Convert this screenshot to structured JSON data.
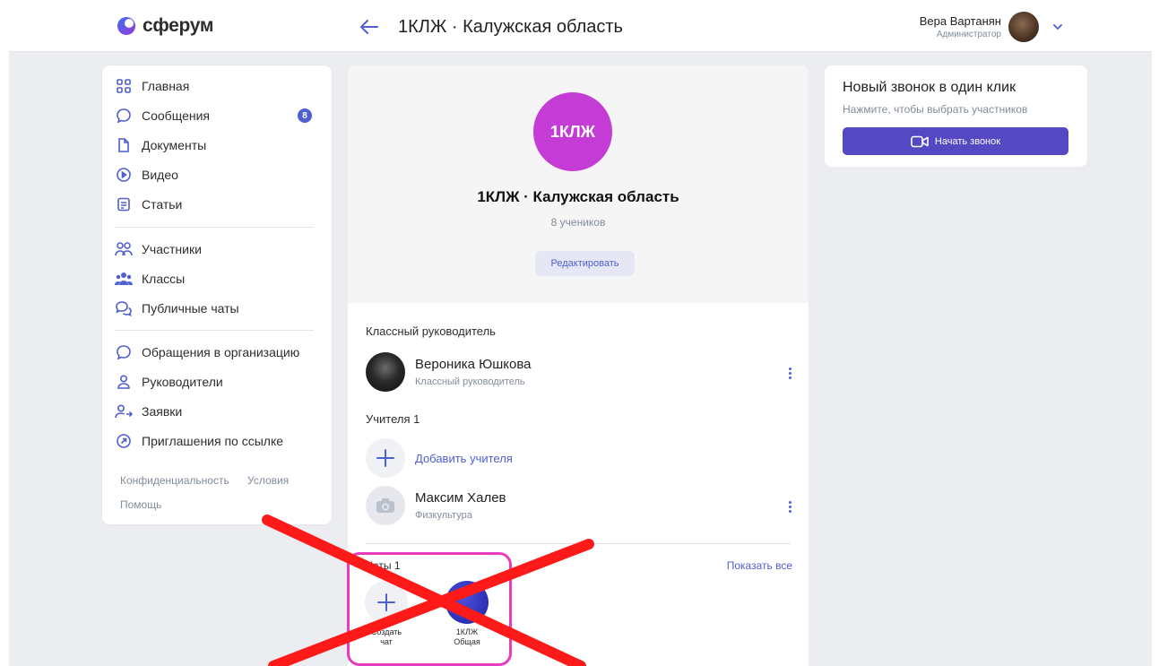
{
  "header": {
    "logo_text": "сферум",
    "title": "1КЛЖ · Калужская область",
    "user_name": "Вера Вартанян",
    "user_role": "Администратор"
  },
  "sidebar": {
    "items": [
      {
        "label": "Главная",
        "icon": "grid-icon"
      },
      {
        "label": "Сообщения",
        "icon": "message-icon",
        "badge": "8"
      },
      {
        "label": "Документы",
        "icon": "document-icon"
      },
      {
        "label": "Видео",
        "icon": "video-icon"
      },
      {
        "label": "Статьи",
        "icon": "article-icon"
      },
      {
        "label": "Участники",
        "icon": "users-icon"
      },
      {
        "label": "Классы",
        "icon": "classes-icon"
      },
      {
        "label": "Публичные чаты",
        "icon": "public-chats-icon"
      },
      {
        "label": "Обращения в организацию",
        "icon": "message-icon"
      },
      {
        "label": "Руководители",
        "icon": "user-icon"
      },
      {
        "label": "Заявки",
        "icon": "user-request-icon"
      },
      {
        "label": "Приглашения по ссылке",
        "icon": "invite-link-icon"
      }
    ],
    "footer": {
      "privacy": "Конфиденциальность",
      "terms": "Условия",
      "help": "Помощь"
    }
  },
  "profile": {
    "avatar_text": "1КЛЖ",
    "title": "1КЛЖ · Калужская область",
    "subtitle": "8 учеников",
    "edit_label": "Редактировать"
  },
  "class_teacher": {
    "section_label": "Классный руководитель",
    "name": "Вероника Юшкова",
    "role": "Классный руководитель"
  },
  "teachers": {
    "section_label": "Учителя 1",
    "add_label": "Добавить учителя",
    "items": [
      {
        "name": "Максим Халев",
        "role": "Физкультура"
      }
    ]
  },
  "chats": {
    "section_label": "Чаты 1",
    "show_all": "Показать все",
    "create_label_1": "Создать",
    "create_label_2": "чат",
    "chat_label_1": "1КЛЖ",
    "chat_label_2": "Общая"
  },
  "call_card": {
    "title": "Новый звонок в один клик",
    "subtitle": "Нажмите, чтобы выбрать участников",
    "button_label": "Начать звонок"
  },
  "colors": {
    "accent": "#4e5fd0",
    "call_button": "#5548c3",
    "group_avatar": "#c53bd6",
    "annotation_cross": "#ff1a1a",
    "annotation_box": "#e83cbe"
  }
}
